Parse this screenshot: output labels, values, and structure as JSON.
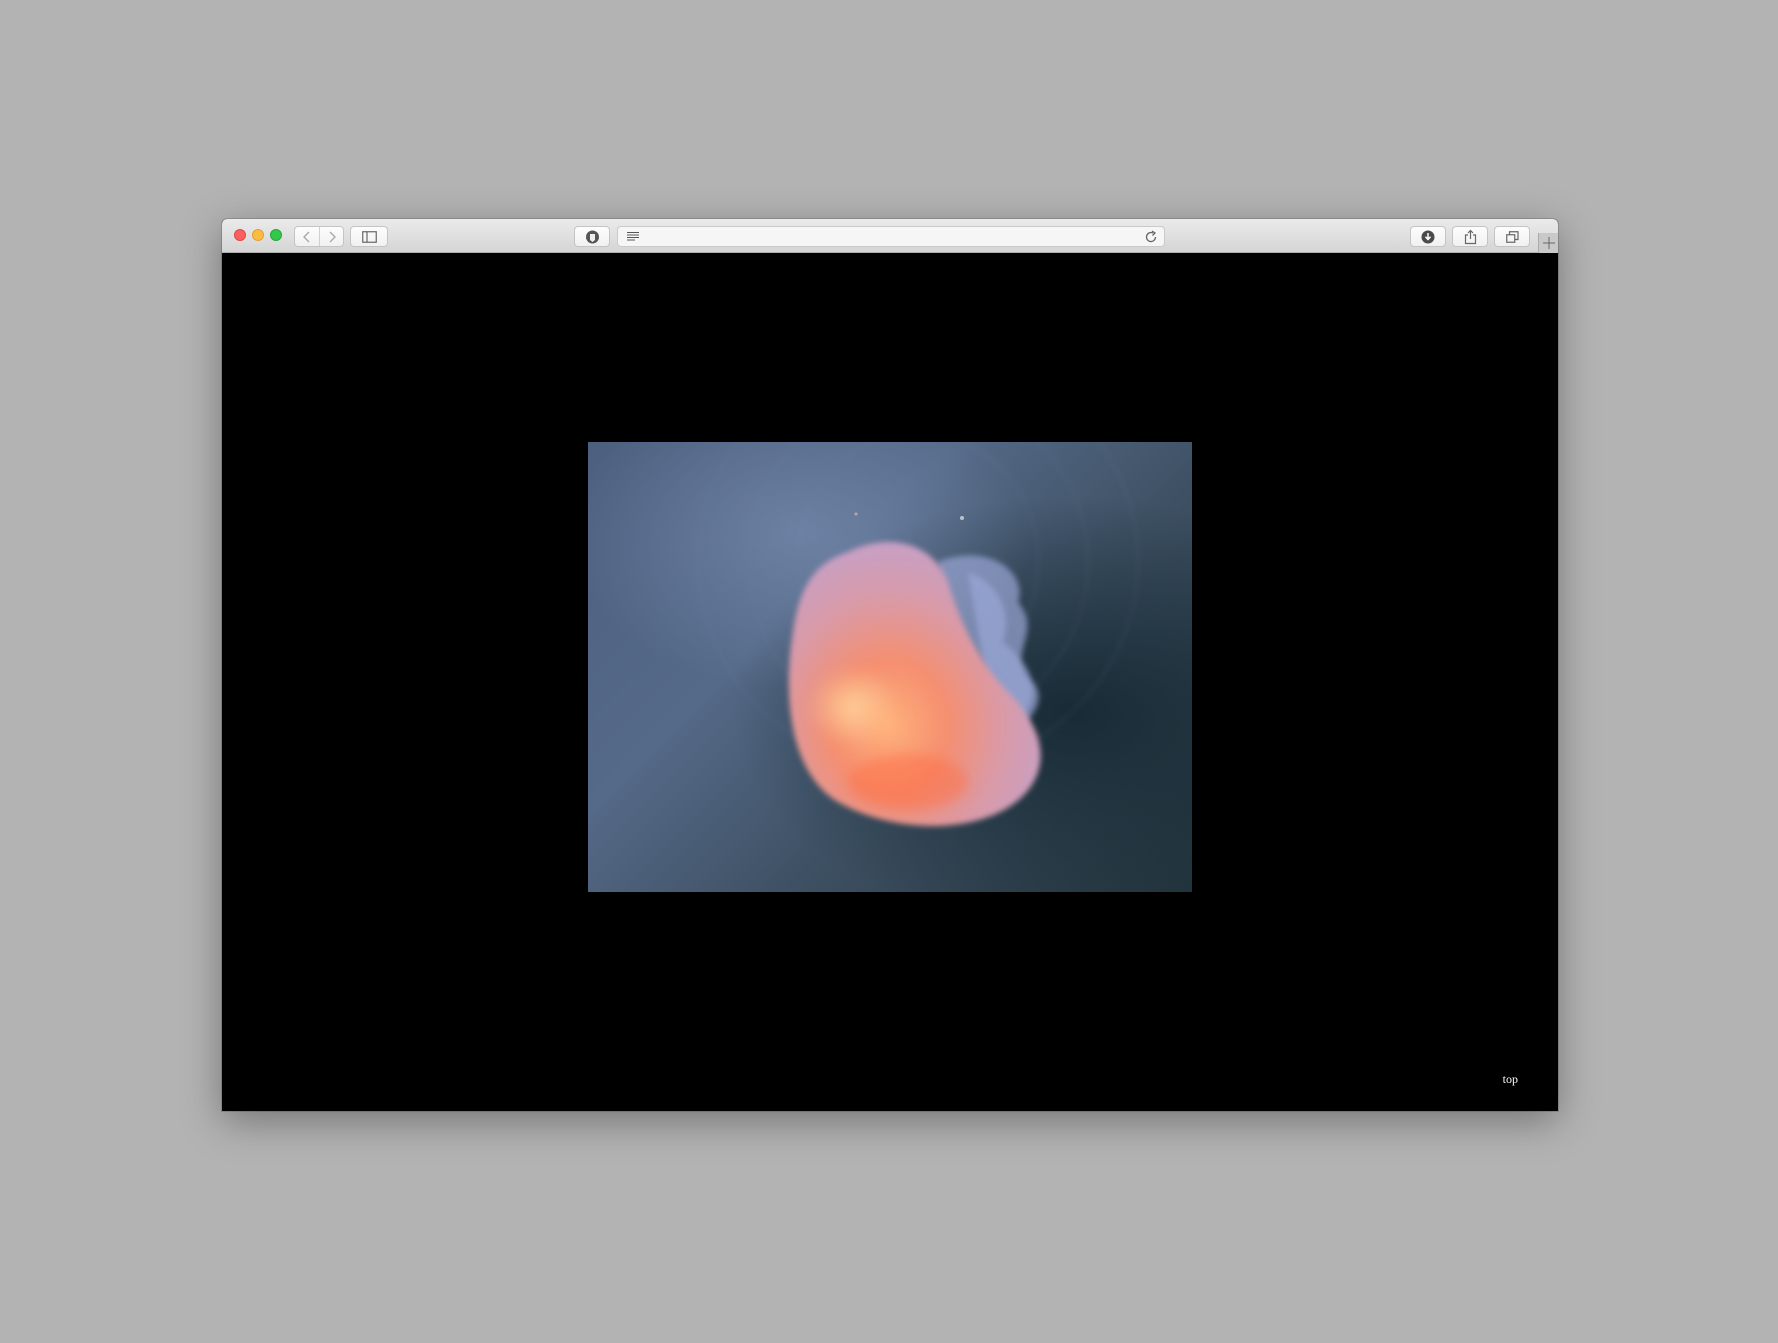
{
  "browser": {
    "address_bar": {
      "url": ""
    },
    "icons": {
      "back": "chevron-left-icon",
      "forward": "chevron-right-icon",
      "sidebar": "sidebar-icon",
      "privacy": "privacy-shield-icon",
      "reader": "reader-icon",
      "reload": "reload-icon",
      "downloads": "download-icon",
      "share": "share-icon",
      "tabs": "tab-overview-icon",
      "new_tab": "plus-icon"
    },
    "colors": {
      "close": "#fc605c",
      "minimize": "#fdbc40",
      "maximize": "#34c84a"
    }
  },
  "page": {
    "background": "#000000",
    "image": {
      "subject": "jellyfish"
    },
    "top_link": "top"
  }
}
